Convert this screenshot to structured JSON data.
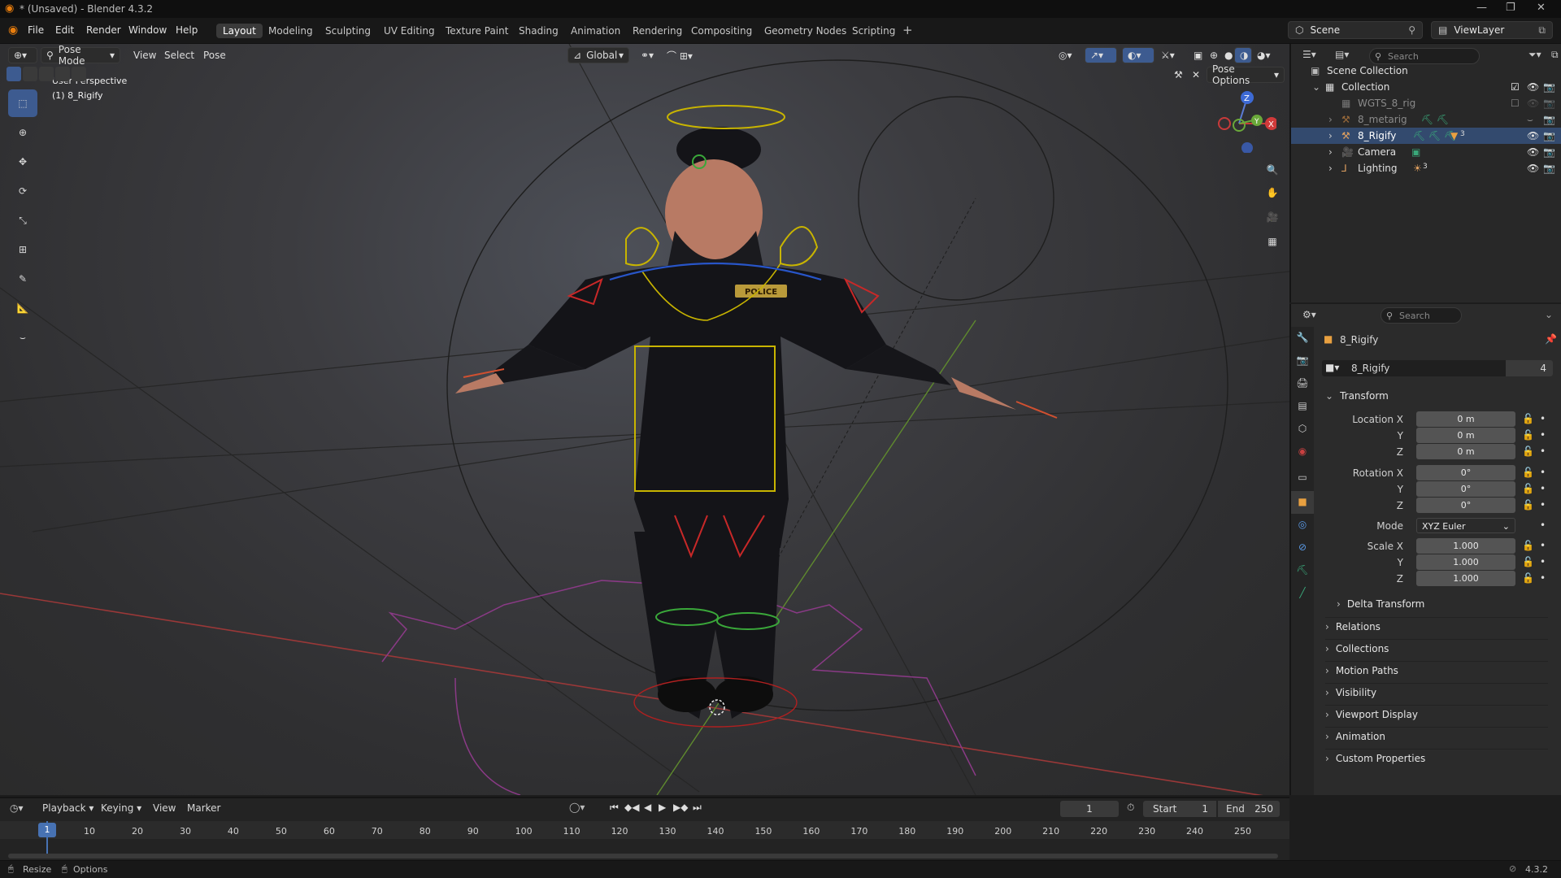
{
  "window": {
    "title": "* (Unsaved) - Blender 4.3.2"
  },
  "menu": [
    "File",
    "Edit",
    "Render",
    "Window",
    "Help"
  ],
  "workspaces": [
    "Layout",
    "Modeling",
    "Sculpting",
    "UV Editing",
    "Texture Paint",
    "Shading",
    "Animation",
    "Rendering",
    "Compositing",
    "Geometry Nodes",
    "Scripting"
  ],
  "active_workspace": "Layout",
  "scene": {
    "scene_label": "Scene",
    "viewlayer_label": "ViewLayer"
  },
  "viewport": {
    "mode": "Pose Mode",
    "menus": [
      "View",
      "Select",
      "Pose"
    ],
    "orientation": "Global",
    "pose_options": "Pose Options",
    "overlay_text": [
      "User Perspective",
      "(1) 8_Rigify"
    ],
    "badge_text": "POLICE"
  },
  "gizmo": {
    "z": "Z",
    "x": "X",
    "y": "Y"
  },
  "outliner": {
    "search_placeholder": "Search",
    "items": [
      {
        "label": "Scene Collection"
      },
      {
        "label": "Collection"
      },
      {
        "label": "WGTS_8_rig"
      },
      {
        "label": "8_metarig"
      },
      {
        "label": "8_Rigify"
      },
      {
        "label": "Camera"
      },
      {
        "label": "Lighting"
      }
    ],
    "rigify_child_count": "3",
    "lighting_child_count": "3"
  },
  "properties": {
    "search_placeholder": "Search",
    "object_name": "8_Rigify",
    "data_name": "8_Rigify",
    "users": "4",
    "transform_label": "Transform",
    "fields": [
      {
        "label": "Location X",
        "value": "0 m"
      },
      {
        "label": "Y",
        "value": "0 m"
      },
      {
        "label": "Z",
        "value": "0 m"
      },
      {
        "label": "Rotation X",
        "value": "0°"
      },
      {
        "label": "Y",
        "value": "0°"
      },
      {
        "label": "Z",
        "value": "0°"
      },
      {
        "label": "Mode",
        "value": "XYZ Euler"
      },
      {
        "label": "Scale X",
        "value": "1.000"
      },
      {
        "label": "Y",
        "value": "1.000"
      },
      {
        "label": "Z",
        "value": "1.000"
      }
    ],
    "sections": [
      "Delta Transform",
      "Relations",
      "Collections",
      "Motion Paths",
      "Visibility",
      "Viewport Display",
      "Animation",
      "Custom Properties"
    ]
  },
  "timeline": {
    "menus": [
      "Playback",
      "Keying",
      "View",
      "Marker"
    ],
    "current_frame": "1",
    "start_label": "Start",
    "start": "1",
    "end_label": "End",
    "end": "250",
    "ticks": [
      "1",
      "10",
      "20",
      "30",
      "40",
      "50",
      "60",
      "70",
      "80",
      "90",
      "100",
      "110",
      "120",
      "130",
      "140",
      "150",
      "160",
      "170",
      "180",
      "190",
      "200",
      "210",
      "220",
      "230",
      "240",
      "250"
    ]
  },
  "status": {
    "left1": "Resize",
    "left2": "Options",
    "version": "4.3.2"
  },
  "colors": {
    "accent": "#4772b3",
    "bone_yellow": "#c8b400",
    "bone_red": "#c82828",
    "bone_green": "#3aa83a",
    "bone_blue": "#2855c8"
  }
}
